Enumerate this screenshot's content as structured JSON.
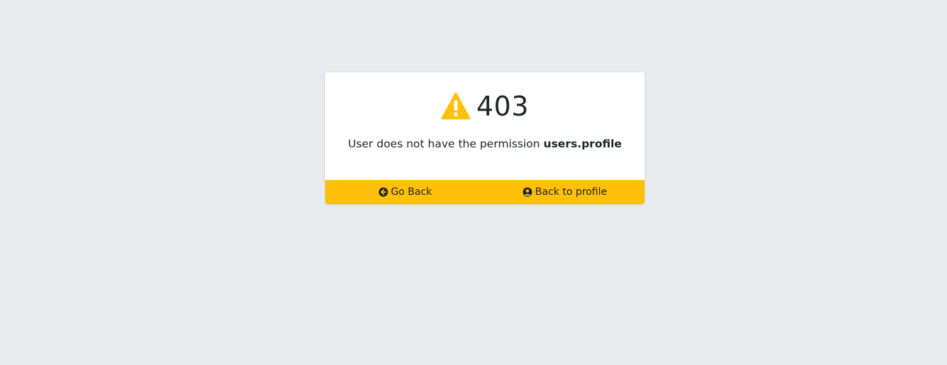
{
  "error": {
    "code": "403",
    "message_prefix": "User does not have the permission ",
    "permission": "users.profile"
  },
  "icons": {
    "warning": "warning-triangle-icon",
    "go_back": "arrow-circle-left-icon",
    "profile": "user-circle-icon"
  },
  "footer": {
    "go_back_label": "Go Back",
    "profile_label": "Back to profile"
  },
  "colors": {
    "background": "#e8ebee",
    "accent": "#ffc107",
    "text": "#212529"
  }
}
